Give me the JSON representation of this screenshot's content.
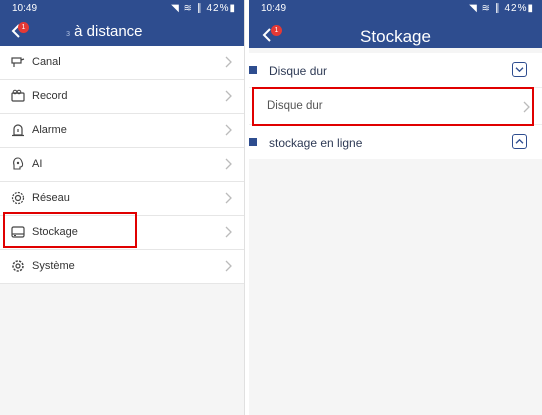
{
  "left": {
    "status": {
      "time": "10:49",
      "icons": "◥ ≋ ∥ 42%▮"
    },
    "badge": "1",
    "title_faded": "з",
    "title": "à distance",
    "menu": [
      {
        "label": "Canal",
        "icon": "camera-icon"
      },
      {
        "label": "Record",
        "icon": "record-icon"
      },
      {
        "label": "Alarme",
        "icon": "alarm-icon"
      },
      {
        "label": "AI",
        "icon": "ai-icon"
      },
      {
        "label": "Réseau",
        "icon": "network-icon"
      },
      {
        "label": "Stockage",
        "icon": "storage-icon"
      },
      {
        "label": "Système",
        "icon": "gear-icon"
      }
    ]
  },
  "right": {
    "status": {
      "time": "10:49",
      "icons": "◥ ≋ ∥ 42%▮"
    },
    "badge": "1",
    "title": "Stockage",
    "sections": [
      {
        "label": "Disque dur",
        "expanded": true,
        "items": [
          "Disque dur"
        ]
      },
      {
        "label": "stockage en ligne",
        "expanded": false
      }
    ]
  },
  "colors": {
    "header": "#2e4d8f",
    "highlight": "#e00000",
    "badge": "#e53935"
  }
}
